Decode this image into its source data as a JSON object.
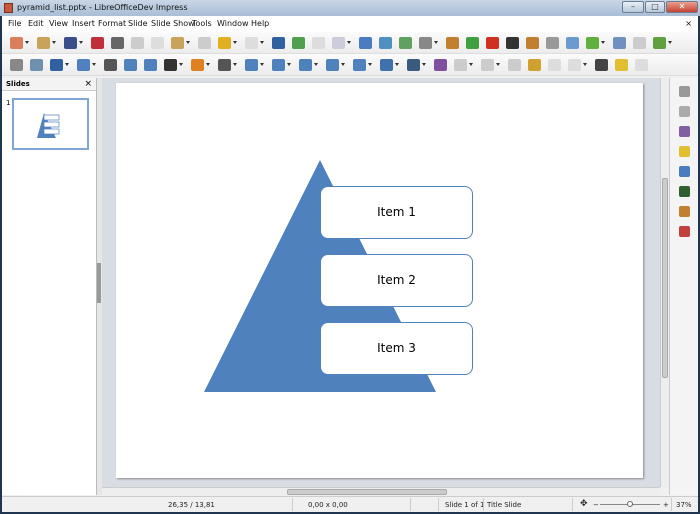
{
  "window": {
    "title": "pyramid_list.pptx - LibreOfficeDev Impress",
    "minimize": "–",
    "maximize": "□",
    "close": "✕"
  },
  "menu": [
    "File",
    "Edit",
    "View",
    "Insert",
    "Format",
    "Slide",
    "Slide Show",
    "Tools",
    "Window",
    "Help"
  ],
  "menu_close": "×",
  "toolbar1": [
    {
      "n": "new-icon",
      "c": "#d9805a",
      "dd": 1
    },
    {
      "n": "open-icon",
      "c": "#c9a35a",
      "dd": 1
    },
    {
      "n": "save-icon",
      "c": "#3a4e8a",
      "dd": 1
    },
    {
      "n": "export-pdf-icon",
      "c": "#c0303a"
    },
    {
      "n": "print-icon",
      "c": "#666"
    },
    {
      "n": "cut-icon",
      "c": "#ccc"
    },
    {
      "n": "copy-icon",
      "c": "#ddd"
    },
    {
      "n": "paste-icon",
      "c": "#c9a35a",
      "dd": 1
    },
    {
      "n": "clone-formatting-icon",
      "c": "#ccc"
    },
    {
      "n": "undo-icon",
      "c": "#e0b020",
      "dd": 1
    },
    {
      "n": "redo-icon",
      "c": "#ddd",
      "dd": 1
    },
    {
      "n": "find-replace-icon",
      "c": "#3060a0"
    },
    {
      "n": "spelling-icon",
      "c": "#50a050"
    },
    {
      "n": "grid-icon",
      "c": "#ddd"
    },
    {
      "n": "display-views-icon",
      "c": "#ccd",
      "dd": 1
    },
    {
      "n": "master-slide-icon",
      "c": "#4a7cc0"
    },
    {
      "n": "start-slideshow-icon",
      "c": "#5090c0"
    },
    {
      "n": "slideshow-current-icon",
      "c": "#60a060"
    },
    {
      "n": "table-icon",
      "c": "#888",
      "dd": 1
    },
    {
      "n": "image-icon",
      "c": "#c08030"
    },
    {
      "n": "media-icon",
      "c": "#40a040"
    },
    {
      "n": "chart-icon",
      "c": "#d03020"
    },
    {
      "n": "text-box-icon",
      "c": "#333"
    },
    {
      "n": "fontwork-icon",
      "c": "#c08030"
    },
    {
      "n": "glue-points-icon",
      "c": "#999"
    },
    {
      "n": "points-mode-icon",
      "c": "#6a9ad0"
    },
    {
      "n": "new-slide-icon",
      "c": "#60b040",
      "dd": 1
    },
    {
      "n": "duplicate-slide-icon",
      "c": "#7090c0"
    },
    {
      "n": "delete-slide-icon",
      "c": "#ccc"
    },
    {
      "n": "slide-layout-icon",
      "c": "#60a040",
      "dd": 1
    }
  ],
  "toolbar2": [
    {
      "n": "select-icon",
      "c": "#888"
    },
    {
      "n": "zoom-icon",
      "c": "#7090b0"
    },
    {
      "n": "line-color-icon",
      "c": "#3060a0",
      "dd": 1
    },
    {
      "n": "fill-color-icon",
      "c": "#5080c0",
      "dd": 1
    },
    {
      "n": "line-icon",
      "c": "#555"
    },
    {
      "n": "rectangle-icon",
      "c": "#4f81bd"
    },
    {
      "n": "ellipse-icon",
      "c": "#4f81bd"
    },
    {
      "n": "arrow-line-icon",
      "c": "#333",
      "dd": 1
    },
    {
      "n": "curve-icon",
      "c": "#e08020",
      "dd": 1
    },
    {
      "n": "connector-icon",
      "c": "#555",
      "dd": 1
    },
    {
      "n": "basic-shapes-icon",
      "c": "#4f81bd",
      "dd": 1
    },
    {
      "n": "symbol-shapes-icon",
      "c": "#4f81bd",
      "dd": 1
    },
    {
      "n": "block-arrows-icon",
      "c": "#4f81bd",
      "dd": 1
    },
    {
      "n": "flowchart-icon",
      "c": "#4f81bd",
      "dd": 1
    },
    {
      "n": "callouts-icon",
      "c": "#4f81bd",
      "dd": 1
    },
    {
      "n": "stars-icon",
      "c": "#3f71ad",
      "dd": 1
    },
    {
      "n": "3d-objects-icon",
      "c": "#3a5a80",
      "dd": 1
    },
    {
      "n": "rotate-icon",
      "c": "#8050a0"
    },
    {
      "n": "align-icon",
      "c": "#ccc",
      "dd": 1
    },
    {
      "n": "arrange-icon",
      "c": "#ccc",
      "dd": 1
    },
    {
      "n": "distribute-icon",
      "c": "#ccc"
    },
    {
      "n": "shadow-icon",
      "c": "#d0a030"
    },
    {
      "n": "crop-icon",
      "c": "#ddd"
    },
    {
      "n": "filter-icon",
      "c": "#ddd",
      "dd": 1
    },
    {
      "n": "points-icon",
      "c": "#444"
    },
    {
      "n": "toggle-extrusion-icon",
      "c": "#e0c030"
    },
    {
      "n": "insert-into-icon",
      "c": "#ddd"
    }
  ],
  "slides_pane": {
    "title": "Slides",
    "close": "×",
    "slide_number": "1"
  },
  "slide": {
    "items": [
      "Item 1",
      "Item 2",
      "Item 3"
    ],
    "shape_color": "#4f81bd"
  },
  "sidebar": [
    {
      "n": "properties-icon",
      "c": "#999"
    },
    {
      "n": "gallery-icon",
      "c": "#aaa"
    },
    {
      "n": "master-pages-icon",
      "c": "#8060a0"
    },
    {
      "n": "custom-animation-icon",
      "c": "#e0c030"
    },
    {
      "n": "slide-transition-icon",
      "c": "#4a7cc0"
    },
    {
      "n": "styles-icon",
      "c": "#306030"
    },
    {
      "n": "navigator-icon",
      "c": "#c08030"
    },
    {
      "n": "functions-icon",
      "c": "#c04040"
    }
  ],
  "status": {
    "position": "26,35 / 13,81",
    "size": "0,00 x 0,00",
    "slide": "Slide 1 of 1",
    "layout": "Title Slide",
    "zoom_minus": "−",
    "zoom_plus": "+",
    "zoom": "37%",
    "zoom_percent": 37
  }
}
